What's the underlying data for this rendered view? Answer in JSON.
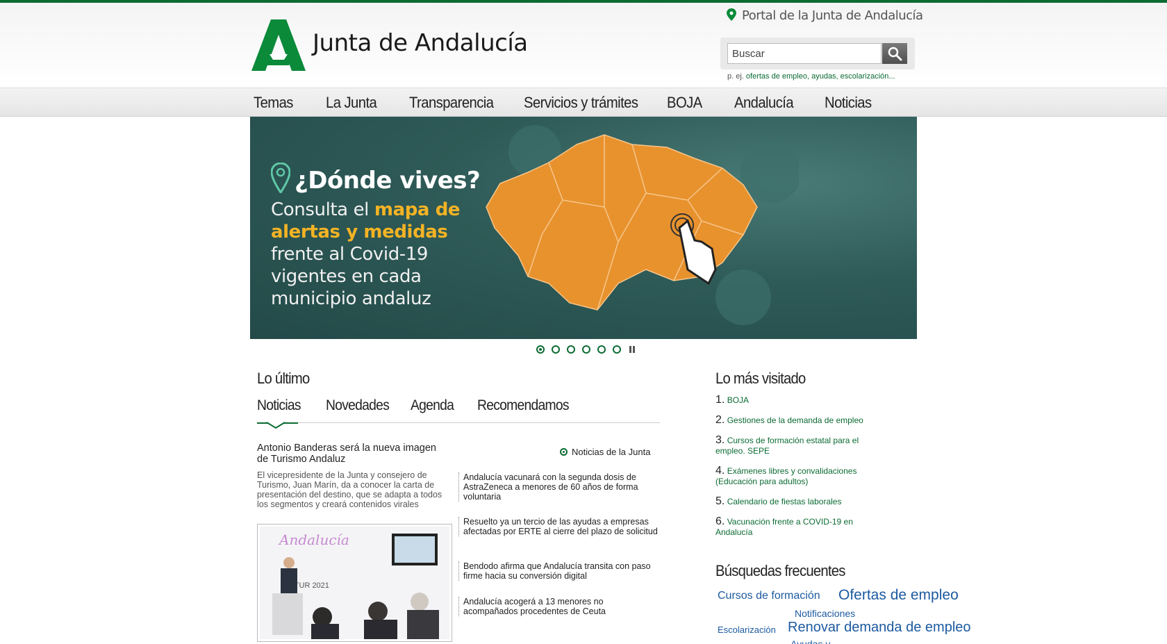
{
  "header": {
    "logo_text": "Junta de Andalucía",
    "portal_link": "Portal de la Junta de Andalucía",
    "search": {
      "placeholder": "Buscar",
      "hint_prefix": "p. ej.",
      "hint_links": "ofertas de empleo, ayudas, escolarización..."
    }
  },
  "nav": {
    "items": [
      "Temas",
      "La Junta",
      "Transparencia",
      "Servicios y trámites",
      "BOJA",
      "Andalucía",
      "Noticias"
    ]
  },
  "banner": {
    "title": "¿Dónde vives?",
    "text_before": "Consulta el",
    "highlight": "mapa de alertas y medidas",
    "text_after": "frente al Covid-19 vigentes en cada municipio andaluz",
    "slide_count": 6,
    "active_slide": 1,
    "colors": {
      "map": "#e8922e",
      "highlight": "#f4b324"
    }
  },
  "lo_ultimo": {
    "title": "Lo último",
    "tabs": [
      "Noticias",
      "Novedades",
      "Agenda",
      "Recomendamos"
    ],
    "active_tab": "Noticias",
    "featured": {
      "title": "Antonio Banderas será la nueva imagen de Turismo Andaluz",
      "description": "El vicepresidente de la Junta y consejero de Turismo, Juan Marín, da a conocer la carta de presentación del destino, que se adapta a todos los segmentos y creará contenidos virales"
    },
    "source_label": "Noticias de la Junta",
    "news": [
      "Andalucía vacunará con la segunda dosis de AstraZeneca a menores de 60 años de forma voluntaria",
      "Resuelto ya un tercio de las ayudas a empresas afectadas por ERTE al cierre del plazo de solicitud",
      "Bendodo afirma que Andalucía transita con paso firme hacia su conversión digital",
      "Andalucía acogerá a 13 menores no acompañados procedentes de Ceuta"
    ]
  },
  "mas_visitado": {
    "title": "Lo más visitado",
    "items": [
      {
        "num": "1.",
        "label": "BOJA"
      },
      {
        "num": "2.",
        "label": "Gestiones de la demanda de empleo"
      },
      {
        "num": "3.",
        "label": "Cursos de formación estatal para el empleo. SEPE"
      },
      {
        "num": "4.",
        "label": "Exámenes libres y convalidaciones (Educación para adultos)"
      },
      {
        "num": "5.",
        "label": "Calendario de fiestas laborales"
      },
      {
        "num": "6.",
        "label": "Vacunación frente a COVID-19 en Andalucía"
      }
    ]
  },
  "busquedas": {
    "title": "Búsquedas frecuentes",
    "tags": [
      "Cursos de formación",
      "Ofertas de empleo",
      "Notificaciones",
      "Escolarización",
      "Renovar demanda de empleo",
      "Ayudas y"
    ]
  },
  "colors": {
    "brand_green": "#0b6b33",
    "tag_blue": "#1c5aa0"
  }
}
